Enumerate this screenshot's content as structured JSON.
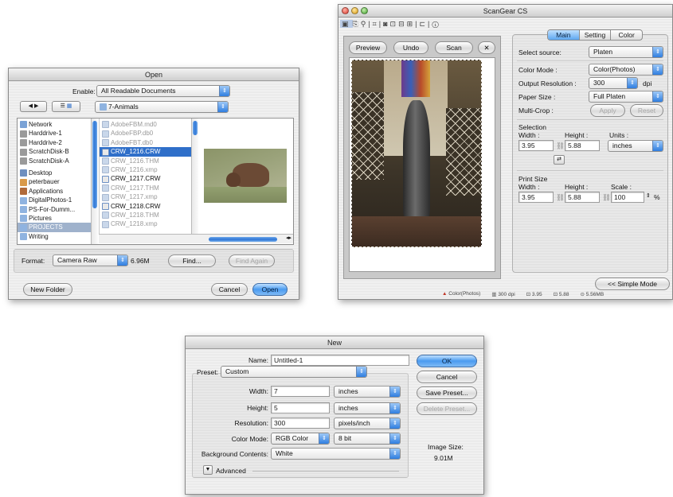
{
  "open_dialog": {
    "title": "Open",
    "enable_label": "Enable:",
    "enable_value": "All Readable Documents",
    "folder_value": "7-Animals",
    "sidebar": [
      "Network",
      "Harddrive-1",
      "Harddrive-2",
      "ScratchDisk-B",
      "ScratchDisk-A",
      "Desktop",
      "peterbauer",
      "Applications",
      "DigitalPhotos-1",
      "PS-For-Dumm...",
      "Pictures",
      "PROJECTS",
      "Writing"
    ],
    "files": [
      "AdobeFBM.md0",
      "AdobeFBP.db0",
      "AdobeFBT.db0",
      "CRW_1216.CRW",
      "CRW_1216.THM",
      "CRW_1216.xmp",
      "CRW_1217.CRW",
      "CRW_1217.THM",
      "CRW_1217.xmp",
      "CRW_1218.CRW",
      "CRW_1218.THM",
      "CRW_1218.xmp"
    ],
    "selected_file": "CRW_1216.CRW",
    "format_label": "Format:",
    "format_value": "Camera Raw",
    "file_size": "6.96M",
    "find_label": "Find...",
    "find_again_label": "Find Again",
    "new_folder_label": "New Folder",
    "cancel_label": "Cancel",
    "open_label": "Open"
  },
  "scangear": {
    "title": "ScanGear CS",
    "preview_label": "Preview",
    "undo_label": "Undo",
    "scan_label": "Scan",
    "tabs": [
      "Main",
      "Setting",
      "Color"
    ],
    "select_source_label": "Select source:",
    "select_source_value": "Platen",
    "color_mode_label": "Color Mode :",
    "color_mode_value": "Color(Photos)",
    "output_res_label": "Output Resolution :",
    "output_res_value": "300",
    "output_res_unit": "dpi",
    "paper_size_label": "Paper Size :",
    "paper_size_value": "Full Platen",
    "multi_crop_label": "Multi-Crop :",
    "apply_label": "Apply",
    "reset_label": "Reset",
    "selection_label": "Selection",
    "width_label": "Width :",
    "height_label": "Height :",
    "units_label": "Units :",
    "sel_width": "3.95",
    "sel_height": "5.88",
    "units_value": "inches",
    "print_size_label": "Print Size",
    "scale_label": "Scale :",
    "print_width": "3.95",
    "print_height": "5.88",
    "scale_value": "100",
    "scale_unit": "%",
    "simple_mode_label": "<< Simple Mode",
    "status": [
      "Color(Photos)",
      "300 dpi",
      "3.95",
      "5.88",
      "5.56MB"
    ]
  },
  "new_dialog": {
    "title": "New",
    "name_label": "Name:",
    "name_value": "Untitled-1",
    "preset_label": "Preset:",
    "preset_value": "Custom",
    "width_label": "Width:",
    "width_value": "7",
    "width_unit": "inches",
    "height_label": "Height:",
    "height_value": "5",
    "height_unit": "inches",
    "resolution_label": "Resolution:",
    "resolution_value": "300",
    "resolution_unit": "pixels/inch",
    "color_mode_label": "Color Mode:",
    "color_mode_value": "RGB Color",
    "bit_depth_value": "8 bit",
    "bg_contents_label": "Background Contents:",
    "bg_contents_value": "White",
    "advanced_label": "Advanced",
    "ok_label": "OK",
    "cancel_label": "Cancel",
    "save_preset_label": "Save Preset...",
    "delete_preset_label": "Delete Preset...",
    "image_size_label": "Image Size:",
    "image_size_value": "9.01M"
  }
}
